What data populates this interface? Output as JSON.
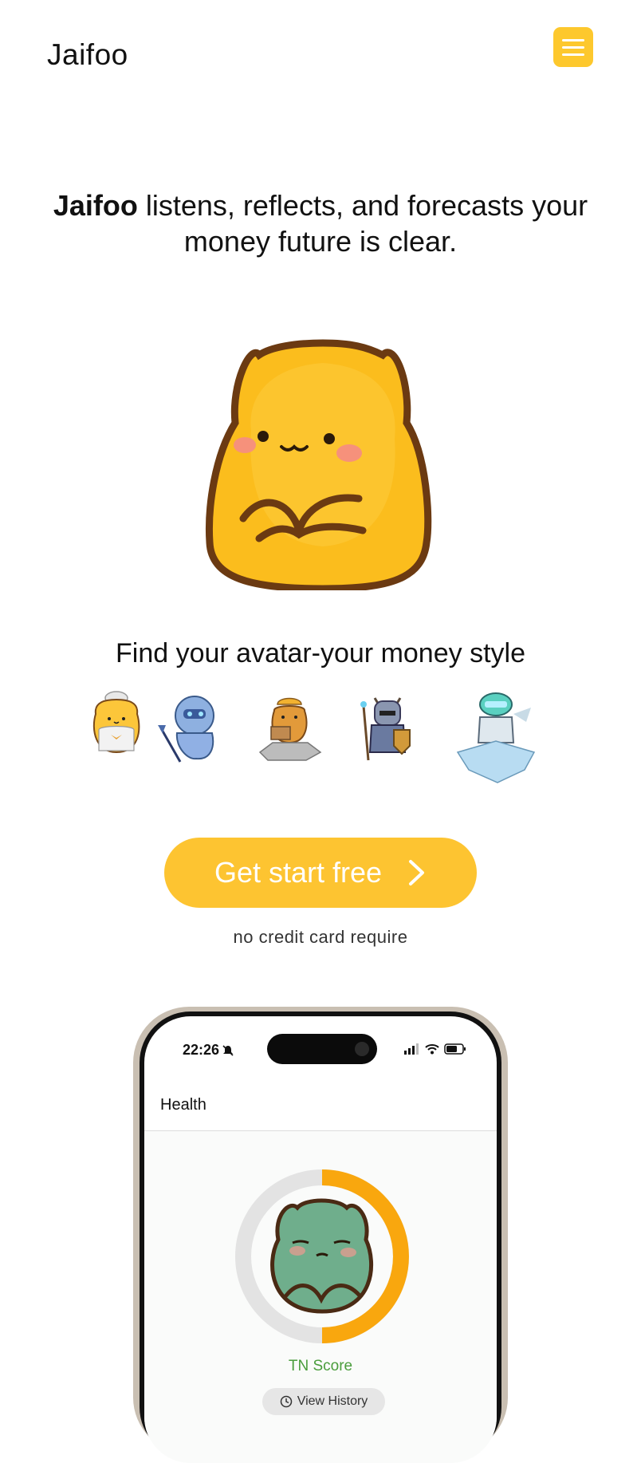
{
  "header": {
    "brand": "Jaifoo",
    "menu_icon": "hamburger-menu-icon"
  },
  "hero": {
    "headline_bold": "Jaifoo",
    "headline_rest": " listens, reflects, and forecasts your money future is clear.",
    "mascot": "yellow-cat-mascot"
  },
  "avatars": {
    "title": "Find your avatar-your money style",
    "items": [
      "chef-cat-avatar",
      "robot-knight-avatar",
      "builder-cat-avatar",
      "armored-knight-avatar",
      "ice-robot-avatar"
    ]
  },
  "cta": {
    "label": "Get start free",
    "arrow_icon": "chevron-right-icon",
    "note": "no credit card require"
  },
  "phone": {
    "time": "22:26",
    "app_title": "Health",
    "score_label": "TN Score",
    "history_button": "View History",
    "score_progress": 0.5
  },
  "colors": {
    "accent": "#fdc431",
    "score_ring": "#f9a70e",
    "score_text": "#4a9d3c"
  }
}
